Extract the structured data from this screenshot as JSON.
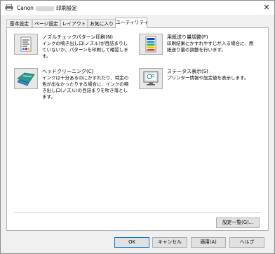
{
  "window": {
    "title_prefix": "Canon",
    "title_suffix": "印刷設定",
    "close_glyph": "✕"
  },
  "tabs": [
    {
      "label": "基本設定"
    },
    {
      "label": "ページ設定"
    },
    {
      "label": "レイアウト"
    },
    {
      "label": "お気に入り"
    },
    {
      "label": "ユーティリティ",
      "selected": true
    }
  ],
  "features": {
    "nozzle_check": {
      "title": "ノズルチェックパターン印刷(N)",
      "desc": "インクの噴き出し口(ノズル)が目詰まりしていないか、パターンを印刷して確認します。",
      "icon": "nozzle-pattern-icon"
    },
    "paper_feed": {
      "title": "用紙送り量調整(F)",
      "desc": "印刷結果にかすれやすじが入る場合に、用紙送り量の調整を行います。",
      "icon": "paper-feed-icon"
    },
    "head_cleaning": {
      "title": "ヘッドクリーニング(C)",
      "desc": "インクは十分あるのにかすれたり、特定の色が出なかったりする場合に、インクの噴き出し口(ノズル)の目詰まりを吹き落とします。",
      "icon": "head-cleaning-icon"
    },
    "status_display": {
      "title": "ステータス表示(S)",
      "desc": "プリンター情報や設定値を表示します。",
      "icon": "status-monitor-icon"
    }
  },
  "buttons": {
    "settings_list": "設定一覧(G)...",
    "ok": "OK",
    "cancel": "キャンセル",
    "apply": "適用(A)",
    "help": "ヘルプ"
  },
  "colors": {
    "accent": "#0078d7",
    "teal": "#2a9a92"
  }
}
